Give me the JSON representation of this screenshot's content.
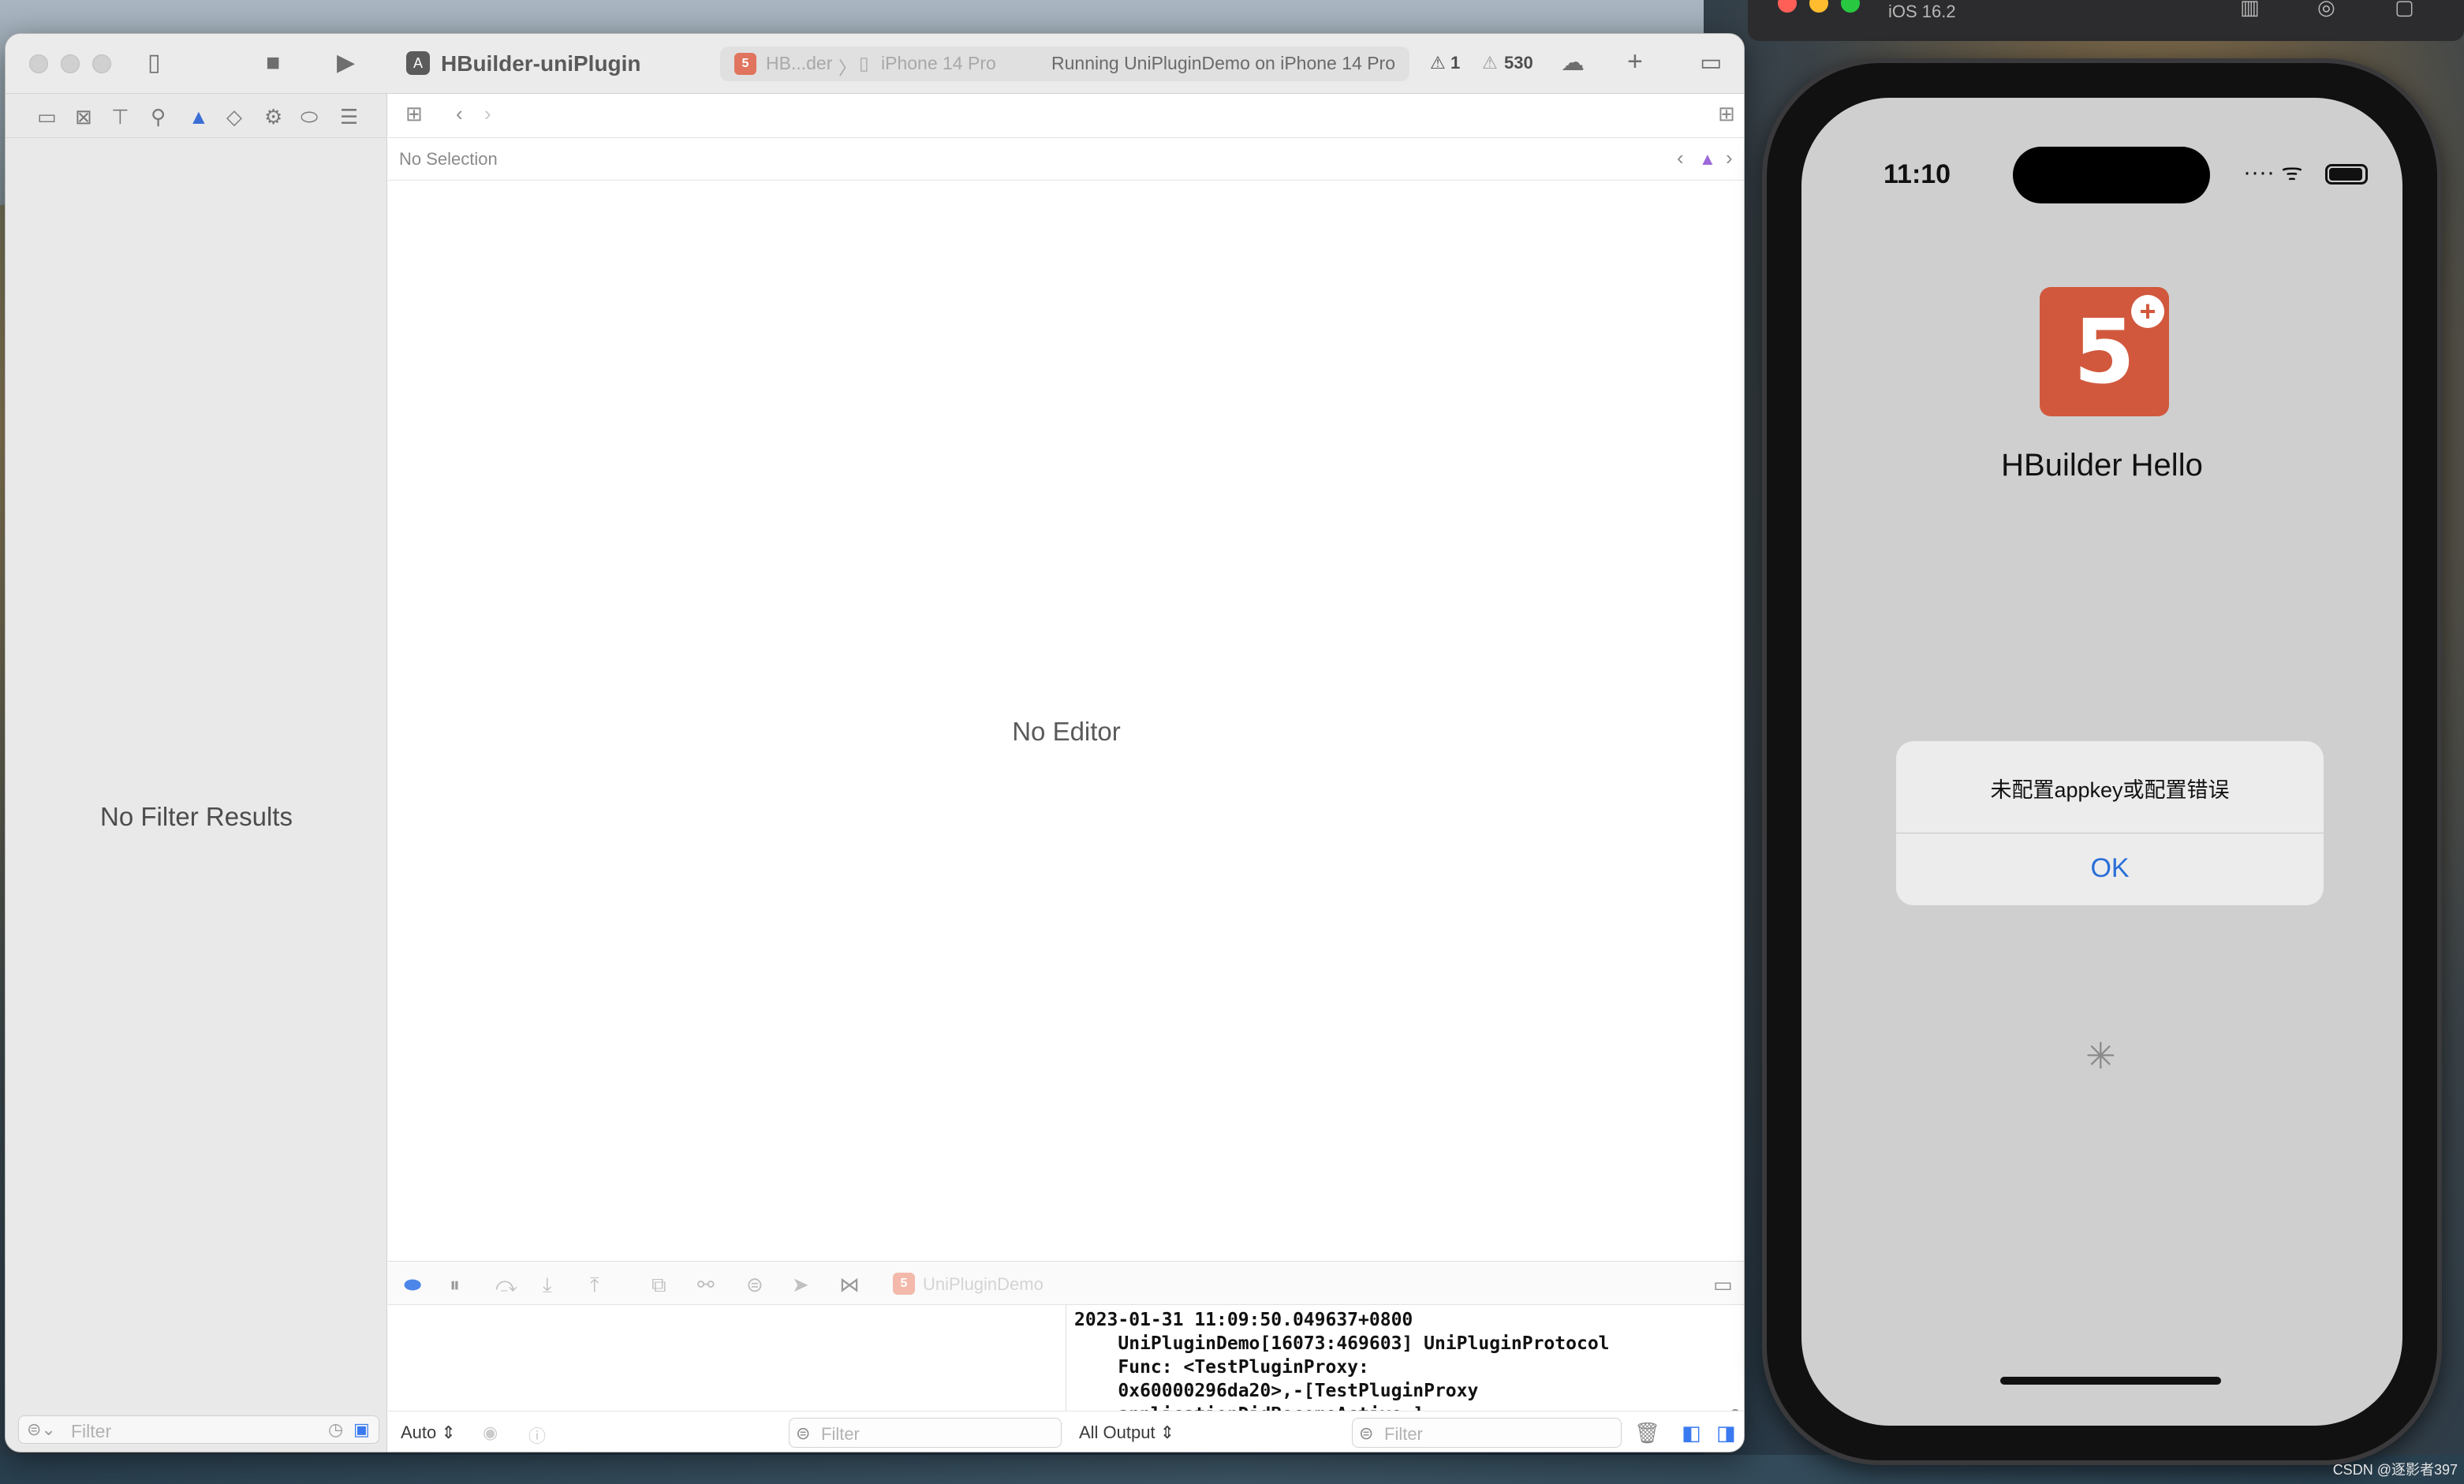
{
  "xcode": {
    "project_title": "HBuilder-uniPlugin",
    "scheme": {
      "target": "HB...der",
      "device": "iPhone 14 Pro",
      "status": "Running UniPluginDemo on iPhone 14 Pro"
    },
    "warnings": {
      "errors_count": "1",
      "warnings_count": "530"
    },
    "navigator": {
      "empty_text": "No Filter Results",
      "filter_placeholder": "Filter"
    },
    "editor": {
      "jump_bar_text": "No Selection",
      "empty_text": "No Editor"
    },
    "debug": {
      "target_label": "UniPluginDemo",
      "console_lines": "2023-01-31 11:09:50.049637+0800\n    UniPluginDemo[16073:469603] UniPluginProtocol\n    Func: <TestPluginProxy:\n    0x60000296da20>,-[TestPluginProxy\n    applicationDidBecomeActive:]",
      "variables_scope": "Auto ⇕",
      "variables_filter_placeholder": "Filter",
      "output_selector": "All Output ⇕",
      "console_filter_placeholder": "Filter"
    }
  },
  "simulator": {
    "os_label": "iOS 16.2",
    "status_time": "11:10",
    "status_right": "····  ᯤ",
    "app_name": "HBuilder Hello",
    "app_icon_glyph": "5",
    "app_icon_badge": "+",
    "alert": {
      "message": "未配置appkey或配置错误",
      "ok_label": "OK"
    },
    "spinner": "✳"
  },
  "watermark": "CSDN @逐影者397",
  "colors": {
    "accent_blue": "#2a6fd8",
    "html5_orange": "#d1583d",
    "warning_purple": "#9b6ad8"
  }
}
